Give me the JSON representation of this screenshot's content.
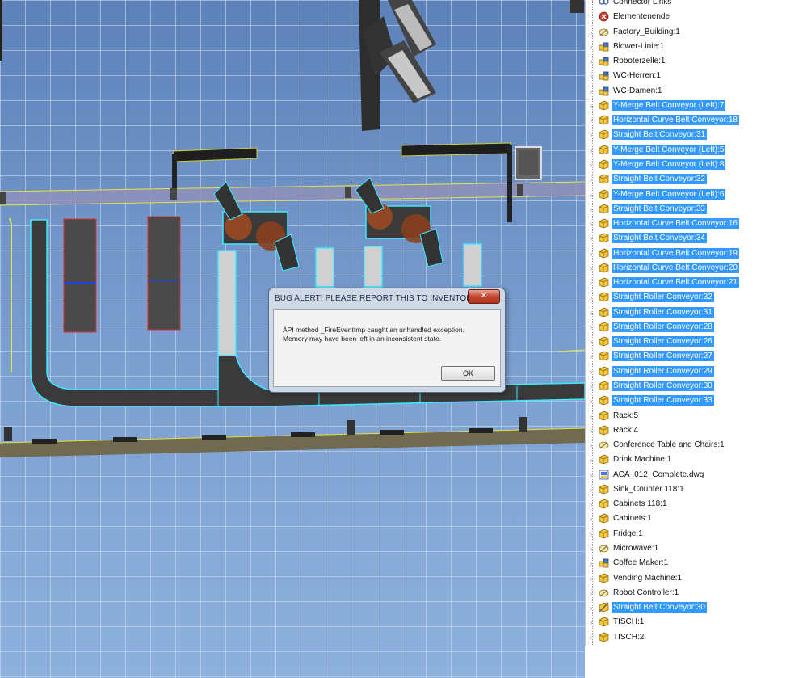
{
  "dialog": {
    "title": "BUG ALERT! PLEASE REPORT THIS TO INVENTOR QA",
    "close_label": "✕",
    "message_line1": "API method _FireEventImp caught an unhandled exception.",
    "message_line2": "Memory may have been left in an inconsistent state.",
    "ok_label": "OK"
  },
  "browser": {
    "items": [
      {
        "label": "Connector Links",
        "icon": "connector-icon",
        "selected": false
      },
      {
        "label": "Elementenende",
        "icon": "end-of-parts-icon",
        "selected": false
      },
      {
        "label": "Factory_Building:1",
        "icon": "building-part-icon",
        "selected": false
      },
      {
        "label": "Blower-Linie:1",
        "icon": "assembly-icon",
        "selected": false
      },
      {
        "label": "Roboterzelle:1",
        "icon": "assembly-icon",
        "selected": false
      },
      {
        "label": "WC-Herren:1",
        "icon": "assembly-icon",
        "selected": false
      },
      {
        "label": "WC-Damen:1",
        "icon": "assembly-icon",
        "selected": false
      },
      {
        "label": "Y-Merge Belt Conveyor (Left):7",
        "icon": "part-icon",
        "selected": true
      },
      {
        "label": "Horizontal Curve Belt Conveyor:18",
        "icon": "part-icon",
        "selected": true
      },
      {
        "label": "Straight Belt Conveyor:31",
        "icon": "part-icon",
        "selected": true
      },
      {
        "label": "Y-Merge Belt Conveyor (Left):5",
        "icon": "part-icon",
        "selected": true
      },
      {
        "label": "Y-Merge Belt Conveyor (Left):8",
        "icon": "part-icon",
        "selected": true
      },
      {
        "label": "Straight Belt Conveyor:32",
        "icon": "part-icon",
        "selected": true
      },
      {
        "label": "Y-Merge Belt Conveyor (Left):6",
        "icon": "part-icon",
        "selected": true
      },
      {
        "label": "Straight Belt Conveyor:33",
        "icon": "part-icon",
        "selected": true
      },
      {
        "label": "Horizontal Curve Belt Conveyor:16",
        "icon": "part-icon",
        "selected": true
      },
      {
        "label": "Straight Belt Conveyor:34",
        "icon": "part-icon",
        "selected": true
      },
      {
        "label": "Horizontal Curve Belt Conveyor:19",
        "icon": "part-icon",
        "selected": true
      },
      {
        "label": "Horizontal Curve Belt Conveyor:20",
        "icon": "part-icon",
        "selected": true
      },
      {
        "label": "Horizontal Curve Belt Conveyor:21",
        "icon": "part-icon",
        "selected": true
      },
      {
        "label": "Straight Roller Conveyor:32",
        "icon": "part-icon",
        "selected": true
      },
      {
        "label": "Straight Roller Conveyor:31",
        "icon": "part-icon",
        "selected": true
      },
      {
        "label": "Straight Roller Conveyor:28",
        "icon": "part-icon",
        "selected": true
      },
      {
        "label": "Straight Roller Conveyor:26",
        "icon": "part-icon",
        "selected": true
      },
      {
        "label": "Straight Roller Conveyor:27",
        "icon": "part-icon",
        "selected": true
      },
      {
        "label": "Straight Roller Conveyor:29",
        "icon": "part-icon",
        "selected": true
      },
      {
        "label": "Straight Roller Conveyor:30",
        "icon": "part-icon",
        "selected": true
      },
      {
        "label": "Straight Roller Conveyor:33",
        "icon": "part-icon",
        "selected": true
      },
      {
        "label": "Rack:5",
        "icon": "part-icon",
        "selected": false
      },
      {
        "label": "Rack:4",
        "icon": "part-icon",
        "selected": false
      },
      {
        "label": "Conference Table and Chairs:1",
        "icon": "building-part-icon",
        "selected": false
      },
      {
        "label": "Drink Machine:1",
        "icon": "part-icon",
        "selected": false
      },
      {
        "label": "ACA_012_Complete.dwg",
        "icon": "dwg-icon",
        "selected": false
      },
      {
        "label": "Sink_Counter 118:1",
        "icon": "part-icon",
        "selected": false
      },
      {
        "label": "Cabinets 118:1",
        "icon": "part-icon",
        "selected": false
      },
      {
        "label": "Cabinets:1",
        "icon": "part-icon",
        "selected": false
      },
      {
        "label": "Fridge:1",
        "icon": "part-icon",
        "selected": false
      },
      {
        "label": "Microwave:1",
        "icon": "building-part-icon",
        "selected": false
      },
      {
        "label": "Coffee Maker:1",
        "icon": "assembly-icon",
        "selected": false
      },
      {
        "label": "Vending Machine:1",
        "icon": "part-icon",
        "selected": false
      },
      {
        "label": "Robot Controller:1",
        "icon": "building-part-icon",
        "selected": false
      },
      {
        "label": "Straight Belt Conveyor:30",
        "icon": "flexible-part-icon",
        "selected": true
      },
      {
        "label": "TISCH:1",
        "icon": "part-icon",
        "selected": false
      },
      {
        "label": "TISCH:2",
        "icon": "part-icon",
        "selected": false
      }
    ]
  },
  "colors": {
    "selection": "#3399ff",
    "highlight_edge": "#33e0ff",
    "viewport_bg": "#6f93c6",
    "dialog_close": "#c4452e"
  }
}
